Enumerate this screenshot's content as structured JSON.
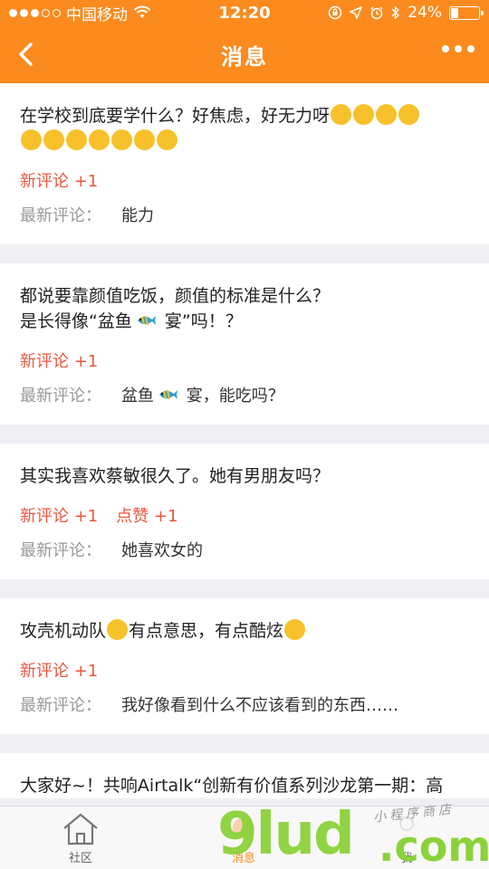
{
  "status_bar": {
    "carrier": "中国移动",
    "time": "12:20",
    "battery_percent": "24%",
    "battery_level": 0.24
  },
  "nav": {
    "title": "消息"
  },
  "cards": [
    {
      "title_prefix": "在学校到底要学什么？好焦虑，好无力呀",
      "meta": [
        "新评论 +1"
      ],
      "latest_label": "最新评论：",
      "latest_text": "能力"
    },
    {
      "title_line1": "都说要靠颜值吃饭，颜值的标准是什么？",
      "title_line2_a": "是长得像“盆鱼",
      "title_line2_b": " 宴”吗！？",
      "meta": [
        "新评论 +1"
      ],
      "latest_label": "最新评论：",
      "latest_text_a": "盆鱼",
      "latest_text_b": " 宴，能吃吗？"
    },
    {
      "title": "其实我喜欢蔡敏很久了。她有男朋友吗？",
      "meta": [
        "新评论 +1",
        "点赞 +1"
      ],
      "latest_label": "最新评论：",
      "latest_text": "她喜欢女的"
    },
    {
      "title_a": "攻壳机动队",
      "title_b": "有点意思，有点酷炫",
      "meta": [
        "新评论 +1"
      ],
      "latest_label": "最新评论：",
      "latest_text": "我好像看到什么不应该看到的东西……"
    },
    {
      "title": "大家好~！共响Airtalk“创新有价值系列沙龙第一期：高"
    }
  ],
  "tabs": [
    {
      "label": "社区"
    },
    {
      "label": "消息"
    },
    {
      "label": "我"
    }
  ],
  "watermark": {
    "logo": "9lud",
    "domain": ".com",
    "tagline": "小程序商店"
  },
  "colors": {
    "accent": "#fb8b1e",
    "meta_red": "#e9573f",
    "watermark_green": "#8bd23a"
  }
}
